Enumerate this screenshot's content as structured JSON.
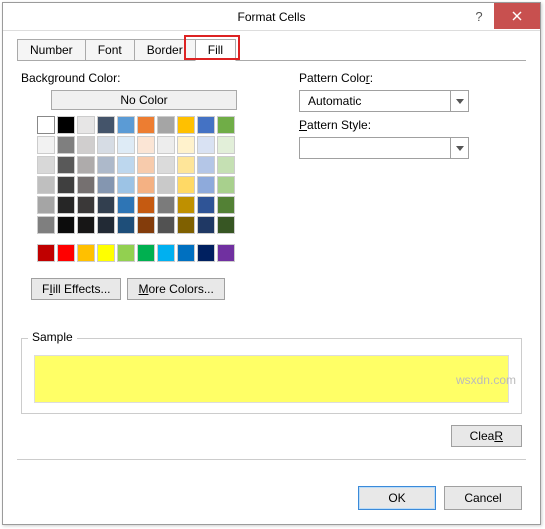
{
  "dialog": {
    "title": "Format Cells",
    "help_label": "?",
    "close_label": "×"
  },
  "tabs": {
    "number": "Number",
    "font": "Font",
    "border": "Border",
    "fill": "Fill",
    "active": "fill"
  },
  "fill": {
    "background_label_pre": "Back",
    "background_label_u": "g",
    "background_label_post": "round Color:",
    "no_color": "No Color",
    "fill_effects_u": "I",
    "fill_effects_rest": "ill Effects...",
    "fill_effects_pre": "F",
    "more_colors_u": "M",
    "more_colors_rest": "ore Colors...",
    "pattern_color_label_pre": "Pattern Colo",
    "pattern_color_label_u": "r",
    "pattern_color_label_post": ":",
    "pattern_color_value": "Automatic",
    "pattern_style_label_pre": "",
    "pattern_style_label_u": "P",
    "pattern_style_label_post": "attern Style:",
    "pattern_style_value": "",
    "theme_colors": [
      "#ffffff",
      "#000000",
      "#e7e6e6",
      "#44546a",
      "#5b9bd5",
      "#ed7d31",
      "#a5a5a5",
      "#ffc000",
      "#4472c4",
      "#70ad47",
      "#f2f2f2",
      "#7f7f7f",
      "#d0cece",
      "#d6dce4",
      "#deebf6",
      "#fbe5d5",
      "#ededed",
      "#fff2cc",
      "#d9e2f3",
      "#e2efd9",
      "#d8d8d8",
      "#595959",
      "#aeabab",
      "#adb9ca",
      "#bdd7ee",
      "#f7cbac",
      "#dbdbdb",
      "#fee599",
      "#b4c6e7",
      "#c5e0b3",
      "#bfbfbf",
      "#3f3f3f",
      "#757070",
      "#8496b0",
      "#9cc3e5",
      "#f4b183",
      "#c9c9c9",
      "#ffd965",
      "#8eaadb",
      "#a8d08d",
      "#a5a5a5",
      "#262626",
      "#3a3838",
      "#323f4f",
      "#2e75b5",
      "#c55a11",
      "#7b7b7b",
      "#bf9000",
      "#2f5496",
      "#538135",
      "#7f7f7f",
      "#0c0c0c",
      "#171616",
      "#222a35",
      "#1e4e79",
      "#833c0b",
      "#525252",
      "#7f6000",
      "#1f3864",
      "#375623"
    ],
    "standard_colors": [
      "#c00000",
      "#ff0000",
      "#ffc000",
      "#ffff00",
      "#92d050",
      "#00b050",
      "#00b0f0",
      "#0070c0",
      "#002060",
      "#7030a0"
    ],
    "sample_label": "Sample",
    "sample_color": "#ffff66"
  },
  "buttons": {
    "clear_u": "R",
    "clear_pre": "Clea",
    "ok": "OK",
    "cancel": "Cancel"
  },
  "watermark": "wsxdn.com"
}
